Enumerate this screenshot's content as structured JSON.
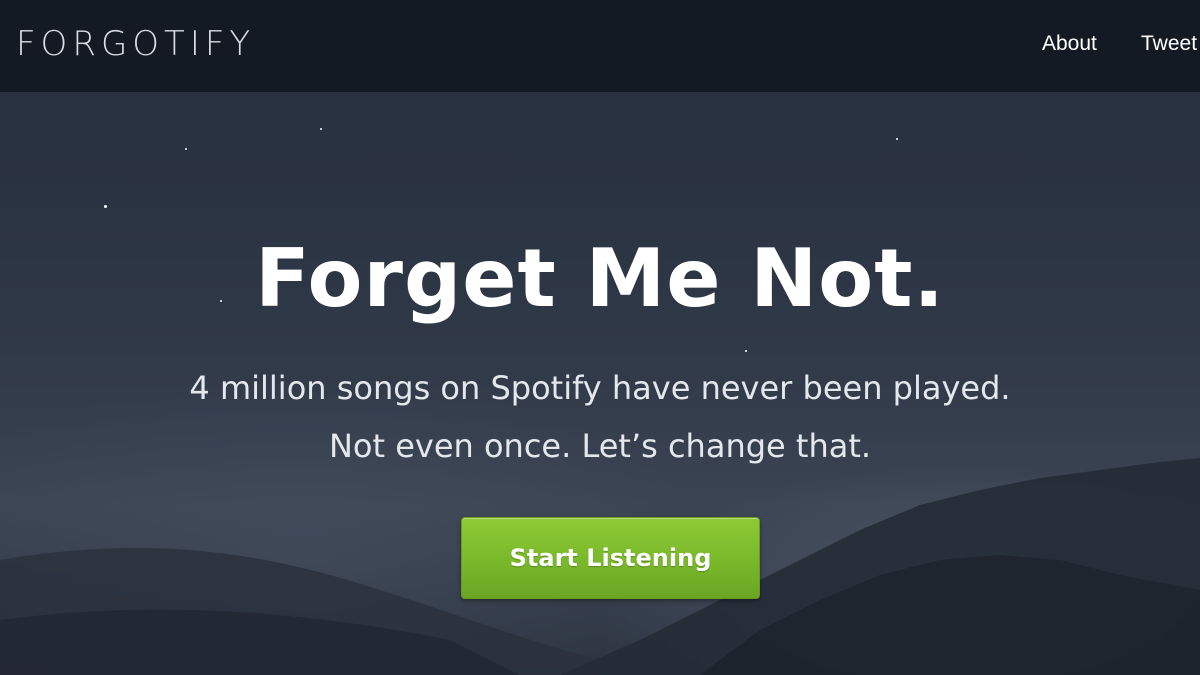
{
  "nav": {
    "logo": "FORGOTIFY",
    "links": [
      "About",
      "Tweet"
    ]
  },
  "hero": {
    "title": "Forget Me Not.",
    "subtitle_line1": "4 million songs on Spotify have never been played.",
    "subtitle_line2": "Not even once. Let’s change that.",
    "cta_label": "Start Listening"
  },
  "colors": {
    "navbar_bg": "#141a24",
    "hero_bg": "#2a3342",
    "cta_green": "#7cbf2b",
    "text": "#ffffff"
  }
}
